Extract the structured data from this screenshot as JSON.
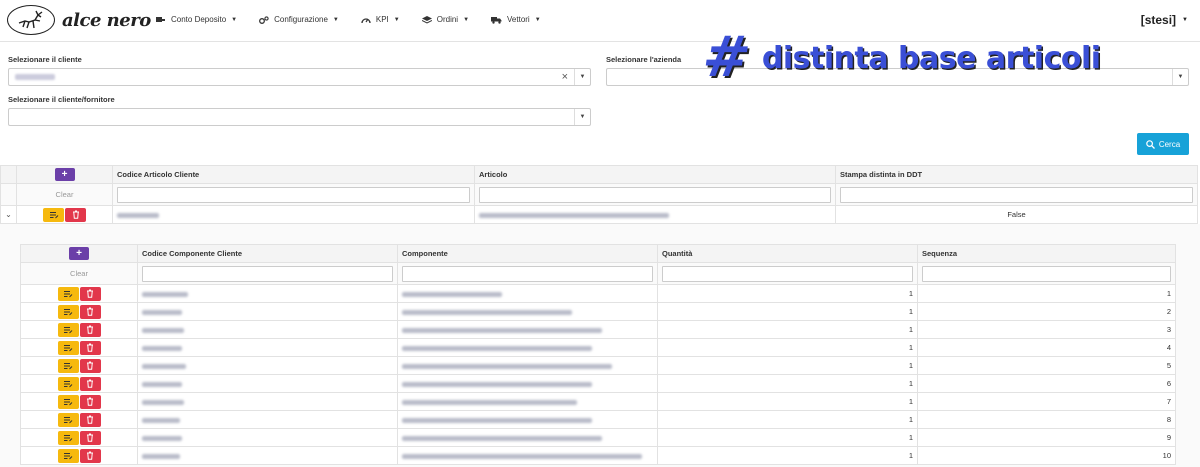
{
  "brand": {
    "name": "alce nero"
  },
  "nav": [
    {
      "label": "Conto Deposito",
      "icon": "truck-plug-icon"
    },
    {
      "label": "Configurazione",
      "icon": "cogs-icon"
    },
    {
      "label": "KPI",
      "icon": "gauge-icon"
    },
    {
      "label": "Ordini",
      "icon": "layers-icon"
    },
    {
      "label": "Vettori",
      "icon": "truck-icon"
    }
  ],
  "user": {
    "name": "[stesi]"
  },
  "overlay": {
    "hash": "#",
    "title": "distinta base articoli"
  },
  "filters": {
    "cliente_label": "Selezionare il cliente",
    "azienda_label": "Selezionare l'azienda",
    "fornitore_label": "Selezionare il cliente/fornitore",
    "clear_symbol": "×"
  },
  "search": {
    "label": "Cerca"
  },
  "main_table": {
    "columns": [
      "Codice Articolo Cliente",
      "Articolo",
      "Stampa distinta in DDT"
    ],
    "clear_label": "Clear",
    "row": {
      "stampa": "False"
    }
  },
  "sub_table": {
    "columns": [
      "Codice Componente Cliente",
      "Componente",
      "Quantità",
      "Sequenza"
    ],
    "clear_label": "Clear",
    "rows": [
      {
        "quantita": "1",
        "sequenza": "1"
      },
      {
        "quantita": "1",
        "sequenza": "2"
      },
      {
        "quantita": "1",
        "sequenza": "3"
      },
      {
        "quantita": "1",
        "sequenza": "4"
      },
      {
        "quantita": "1",
        "sequenza": "5"
      },
      {
        "quantita": "1",
        "sequenza": "6"
      },
      {
        "quantita": "1",
        "sequenza": "7"
      },
      {
        "quantita": "1",
        "sequenza": "8"
      },
      {
        "quantita": "1",
        "sequenza": "9"
      },
      {
        "quantita": "1",
        "sequenza": "10"
      }
    ]
  },
  "colors": {
    "accent_blue": "#3a4fd6",
    "search_button": "#17a2d8",
    "add_button": "#6b3fa8",
    "edit_button": "#f6b90e",
    "delete_button": "#e2374b"
  }
}
